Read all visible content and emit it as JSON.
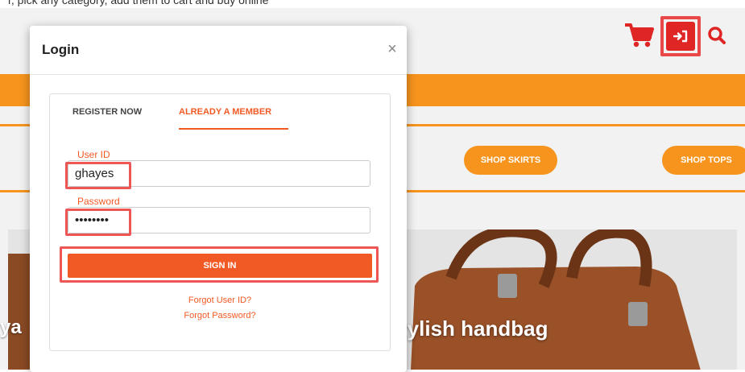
{
  "top_strip_text": "r, pick any category, add them to cart and buy online",
  "header": {
    "icons": [
      "cart-icon",
      "login-icon",
      "search-icon"
    ]
  },
  "category_buttons": [
    {
      "label": "SHOP SKIRTS"
    },
    {
      "label": "SHOP TOPS"
    }
  ],
  "hero": {
    "left_text": "ya",
    "right_text": "tylish handbag"
  },
  "modal": {
    "title": "Login",
    "close_symbol": "×",
    "tabs": [
      {
        "label": "REGISTER NOW",
        "active": false
      },
      {
        "label": "ALREADY A MEMBER",
        "active": true
      }
    ],
    "user_id": {
      "label": "User ID",
      "value": "ghayes"
    },
    "password": {
      "label": "Password",
      "value": "••••••••"
    },
    "sign_in_label": "SIGN IN",
    "forgot_user_id": "Forgot User ID?",
    "forgot_password": "Forgot Password?"
  },
  "colors": {
    "accent_orange": "#f7941d",
    "button_orange": "#f15a24",
    "icon_red": "#e02525",
    "highlight_red": "#ee5555"
  }
}
